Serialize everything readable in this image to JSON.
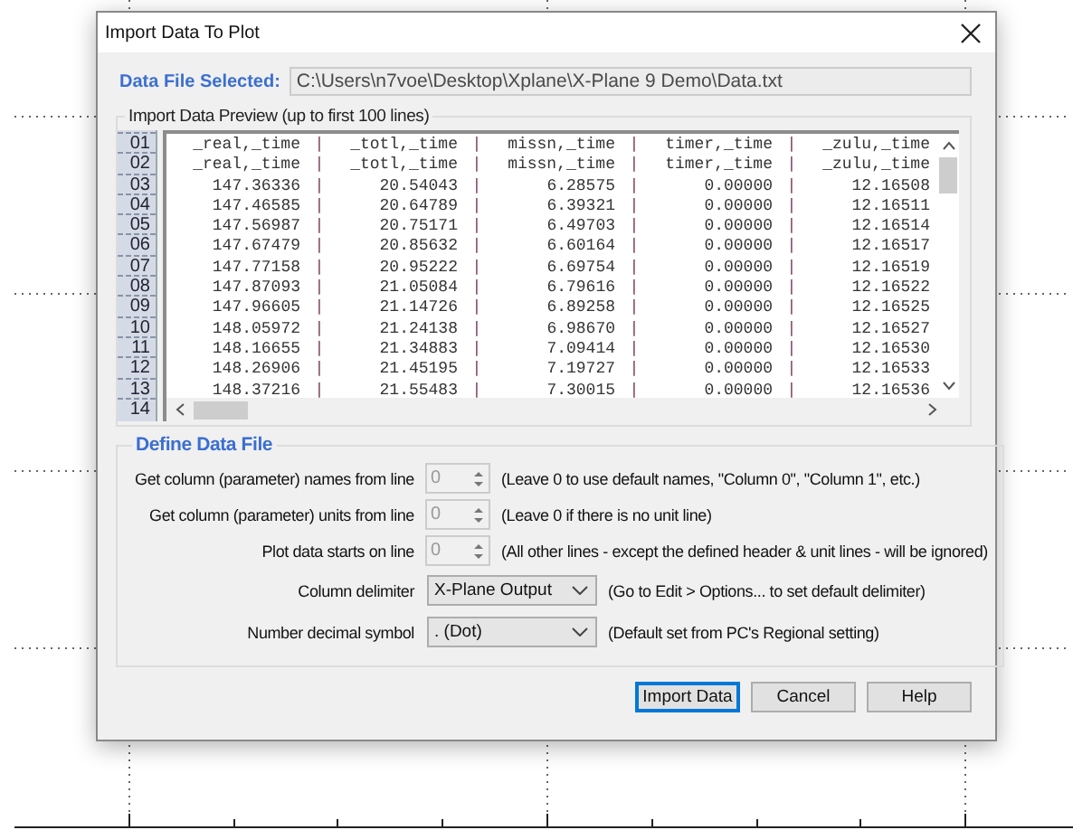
{
  "window": {
    "title": "Import Data To Plot"
  },
  "file": {
    "label": "Data File Selected:",
    "value": "C:\\Users\\n7voe\\Desktop\\Xplane\\X-Plane 9 Demo\\Data.txt"
  },
  "preview": {
    "title": "Import Data Preview (up to first 100 lines)",
    "line_numbers": [
      "01",
      "02",
      "03",
      "04",
      "05",
      "06",
      "07",
      "08",
      "09",
      "10",
      "11",
      "12",
      "13",
      "14"
    ],
    "rows": [
      [
        "_real,_time",
        "|",
        "_totl,_time",
        "|",
        "missn,_time",
        "|",
        "timer,_time",
        "|",
        "_zulu,_time"
      ],
      [
        "_real,_time",
        "|",
        "_totl,_time",
        "|",
        "missn,_time",
        "|",
        "timer,_time",
        "|",
        "_zulu,_time"
      ],
      [
        "147.36336",
        "|",
        "20.54043",
        "|",
        "6.28575",
        "|",
        "0.00000",
        "|",
        "12.16508"
      ],
      [
        "147.46585",
        "|",
        "20.64789",
        "|",
        "6.39321",
        "|",
        "0.00000",
        "|",
        "12.16511"
      ],
      [
        "147.56987",
        "|",
        "20.75171",
        "|",
        "6.49703",
        "|",
        "0.00000",
        "|",
        "12.16514"
      ],
      [
        "147.67479",
        "|",
        "20.85632",
        "|",
        "6.60164",
        "|",
        "0.00000",
        "|",
        "12.16517"
      ],
      [
        "147.77158",
        "|",
        "20.95222",
        "|",
        "6.69754",
        "|",
        "0.00000",
        "|",
        "12.16519"
      ],
      [
        "147.87093",
        "|",
        "21.05084",
        "|",
        "6.79616",
        "|",
        "0.00000",
        "|",
        "12.16522"
      ],
      [
        "147.96605",
        "|",
        "21.14726",
        "|",
        "6.89258",
        "|",
        "0.00000",
        "|",
        "12.16525"
      ],
      [
        "148.05972",
        "|",
        "21.24138",
        "|",
        "6.98670",
        "|",
        "0.00000",
        "|",
        "12.16527"
      ],
      [
        "148.16655",
        "|",
        "21.34883",
        "|",
        "7.09414",
        "|",
        "0.00000",
        "|",
        "12.16530"
      ],
      [
        "148.26906",
        "|",
        "21.45195",
        "|",
        "7.19727",
        "|",
        "0.00000",
        "|",
        "12.16533"
      ],
      [
        "148.37216",
        "|",
        "21.55483",
        "|",
        "7.30015",
        "|",
        "0.00000",
        "|",
        "12.16536"
      ]
    ]
  },
  "define": {
    "title": "Define Data File",
    "fields": [
      {
        "kind": "spinner",
        "label": "Get column (parameter) names from line",
        "value": "0",
        "disabled": true,
        "hint": "(Leave 0 to use default names, \"Column 0\", \"Column 1\", etc.)"
      },
      {
        "kind": "spinner",
        "label": "Get column (parameter) units from line",
        "value": "0",
        "disabled": true,
        "hint": "(Leave 0 if there is no unit line)"
      },
      {
        "kind": "spinner",
        "label": "Plot data starts on line",
        "value": "0",
        "disabled": true,
        "hint": "(All other lines - except the defined header & unit lines - will be ignored)"
      },
      {
        "kind": "dropdown",
        "label": "Column delimiter",
        "value": "X-Plane Output",
        "hint": "(Go to Edit > Options... to set default delimiter)"
      },
      {
        "kind": "dropdown",
        "label": "Number decimal symbol",
        "value": ". (Dot)",
        "hint": "(Default set from PC's Regional setting)"
      }
    ]
  },
  "buttons": [
    {
      "label": "Import Data",
      "default": true
    },
    {
      "label": "Cancel",
      "default": false
    },
    {
      "label": "Help",
      "default": false
    }
  ]
}
